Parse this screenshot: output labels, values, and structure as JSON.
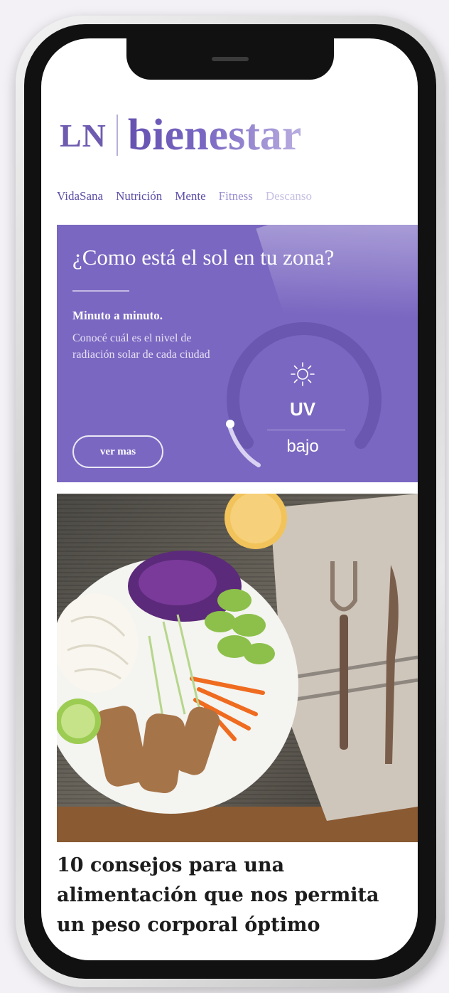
{
  "header": {
    "logo_ln": "LN",
    "logo_word": "bienestar"
  },
  "nav": {
    "items": [
      "VidaSana",
      "Nutrición",
      "Mente",
      "Fitness",
      "Descanso"
    ]
  },
  "uv_card": {
    "title": "¿Como está el sol en tu zona?",
    "subtitle": "Minuto a minuto.",
    "description": "Conocé cuál es el nivel de radiación solar de cada ciudad",
    "button_label": "ver mas",
    "gauge_label": "UV",
    "gauge_level": "bajo",
    "gauge_value_fraction": 0.15,
    "sun_icon": "sun-icon"
  },
  "article": {
    "title": "10 consejos para una alimentación que nos permita un peso corporal óptimo",
    "image": "salad-plate-photo"
  },
  "colors": {
    "brand": "#6e5bb0",
    "card_bg": "#7a67c1"
  }
}
